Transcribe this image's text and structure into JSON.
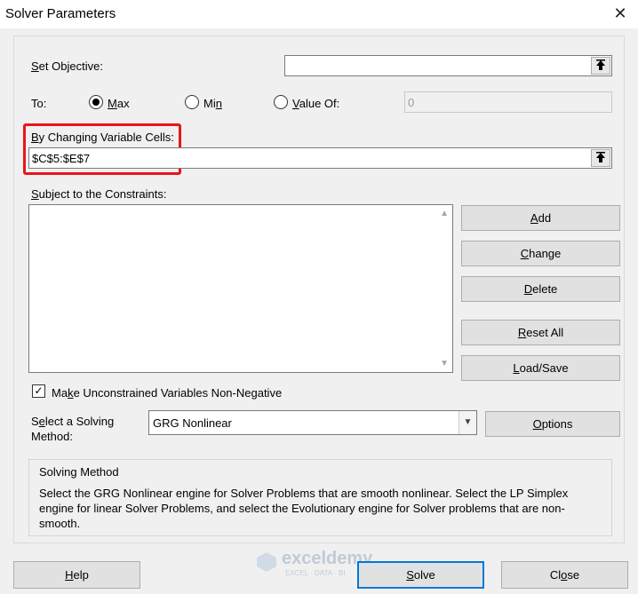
{
  "window": {
    "title": "Solver Parameters"
  },
  "objective": {
    "label_prefix": "",
    "label_mnemonic": "S",
    "label_rest": "et Objective:",
    "value": ""
  },
  "to": {
    "label": "To:",
    "options": [
      {
        "mnemonic": "M",
        "rest": "ax",
        "selected": true
      },
      {
        "mnemonic": "",
        "rest": "Mi",
        "mnemonic2": "n",
        "selected": false
      },
      {
        "mnemonic": "V",
        "rest": "alue Of:",
        "selected": false
      }
    ],
    "value_of": "0"
  },
  "changing": {
    "label_mnemonic": "B",
    "label_rest": "y Changing Variable Cells:",
    "value": "$C$5:$E$7"
  },
  "constraints": {
    "label_mnemonic": "S",
    "label_rest": "ubject to the Constraints:",
    "items": []
  },
  "side_buttons": {
    "add": {
      "mnemonic": "A",
      "rest": "dd"
    },
    "change": {
      "mnemonic": "C",
      "rest": "hange"
    },
    "delete": {
      "mnemonic": "D",
      "rest": "elete"
    },
    "reset": {
      "mnemonic": "R",
      "rest": "eset All"
    },
    "loadsave": {
      "mnemonic": "L",
      "rest": "oad/Save"
    }
  },
  "nonneg": {
    "checked": true,
    "label_mnemonic": "k",
    "label_prefix": "Ma",
    "label_rest": "e Unconstrained Variables Non-Negative"
  },
  "method": {
    "label_line1_mnemonic": "e",
    "label_line1_prefix": "S",
    "label_line1_rest": "lect a Solving",
    "label_line2": "Method:",
    "selected": "GRG Nonlinear",
    "options_button": {
      "mnemonic": "O",
      "rest": "ptions"
    }
  },
  "description": {
    "heading": "Solving Method",
    "text": "Select the GRG Nonlinear engine for Solver Problems that are smooth nonlinear. Select the LP Simplex engine for linear Solver Problems, and select the Evolutionary engine for Solver problems that are non-smooth."
  },
  "footer": {
    "help": {
      "mnemonic": "H",
      "rest": "elp"
    },
    "solve": {
      "mnemonic": "S",
      "rest": "olve"
    },
    "close": {
      "prefix": "Cl",
      "mnemonic": "o",
      "rest": "se"
    }
  },
  "watermark": {
    "brand": "exceldemy",
    "tagline": "EXCEL · DATA · BI"
  },
  "colors": {
    "highlight": "#e8141c",
    "primary_border": "#0078d7"
  }
}
